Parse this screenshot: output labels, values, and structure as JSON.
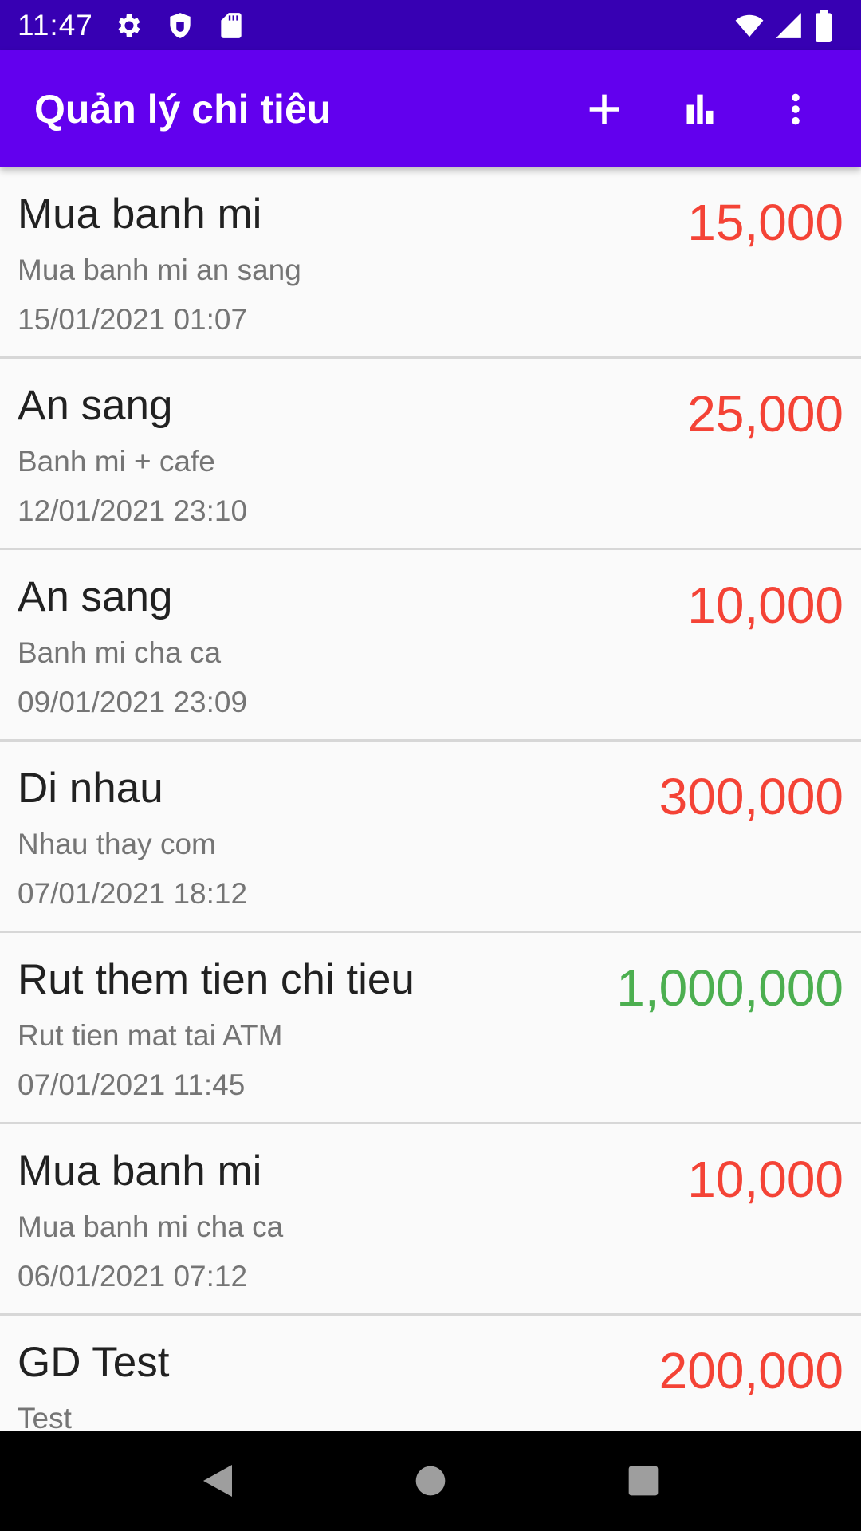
{
  "status_bar": {
    "time": "11:47",
    "left_icons": [
      "gear-icon",
      "shield-icon",
      "sd-card-icon"
    ],
    "right_icons": [
      "wifi-icon",
      "signal-icon",
      "battery-icon"
    ]
  },
  "app_bar": {
    "title": "Quản lý chi tiêu",
    "actions": [
      "add-icon",
      "bar-chart-icon",
      "more-vert-icon"
    ],
    "background": "#6200ee"
  },
  "colors": {
    "expense": "#f44336",
    "income": "#4caf50",
    "status_bar": "#3700b3"
  },
  "transactions": [
    {
      "title": "Mua banh mi",
      "description": "Mua banh mi an sang",
      "date": "15/01/2021 01:07",
      "amount": "15,000",
      "type": "expense"
    },
    {
      "title": "An sang",
      "description": "Banh mi + cafe",
      "date": "12/01/2021 23:10",
      "amount": "25,000",
      "type": "expense"
    },
    {
      "title": "An sang",
      "description": "Banh mi cha ca",
      "date": "09/01/2021 23:09",
      "amount": "10,000",
      "type": "expense"
    },
    {
      "title": "Di nhau",
      "description": "Nhau thay com",
      "date": "07/01/2021 18:12",
      "amount": "300,000",
      "type": "expense"
    },
    {
      "title": "Rut them tien chi tieu",
      "description": "Rut tien mat tai ATM",
      "date": "07/01/2021 11:45",
      "amount": "1,000,000",
      "type": "income"
    },
    {
      "title": "Mua banh mi",
      "description": "Mua banh mi cha ca",
      "date": "06/01/2021 07:12",
      "amount": "10,000",
      "type": "expense"
    },
    {
      "title": "GD Test",
      "description": "Test",
      "date": "",
      "amount": "200,000",
      "type": "expense"
    }
  ],
  "nav_bar": {
    "buttons": [
      "back-icon",
      "home-icon",
      "recents-icon"
    ]
  }
}
